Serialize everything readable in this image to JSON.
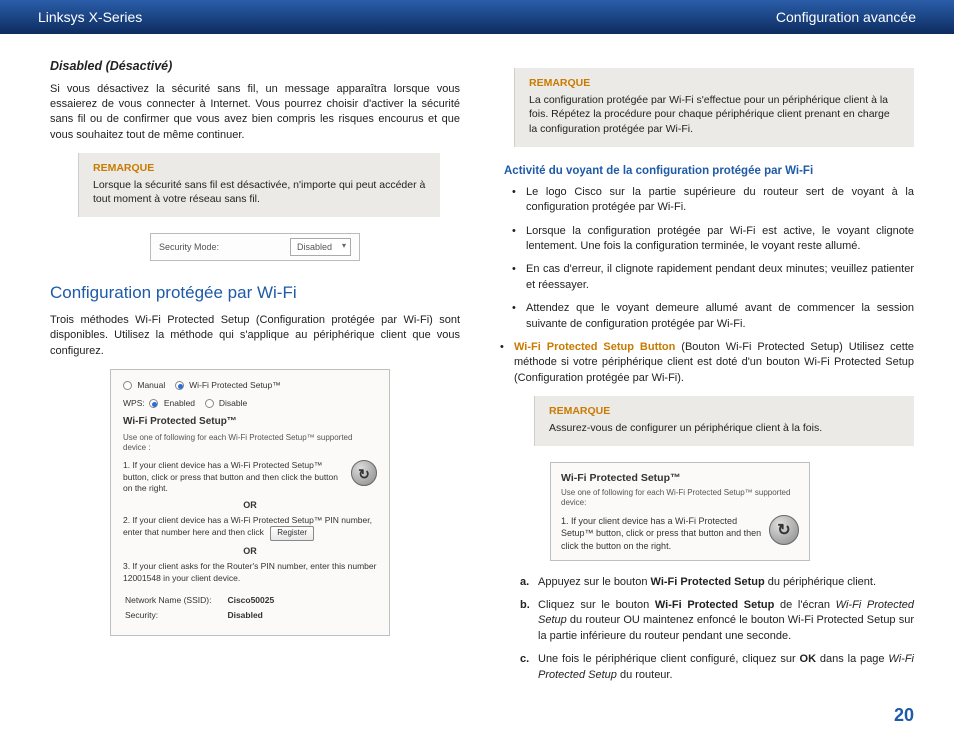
{
  "header": {
    "left": "Linksys X-Series",
    "right": "Configuration avancée"
  },
  "left": {
    "disabled_heading": "Disabled (Désactivé)",
    "disabled_body": "Si vous désactivez la sécurité sans fil, un message apparaîtra lorsque vous essaierez de vous connecter à Internet. Vous pourrez choisir d'activer la sécurité sans fil ou de confirmer que vous avez bien compris les risques encourus et que vous souhaitez tout de même continuer.",
    "note1": {
      "title": "REMARQUE",
      "body": "Lorsque la sécurité sans fil est désactivée, n'importe qui peut accéder à tout moment à votre réseau sans fil."
    },
    "security_label": "Security Mode:",
    "security_value": "Disabled",
    "wps_heading": "Configuration protégée par Wi-Fi",
    "wps_body": "Trois méthodes Wi-Fi Protected Setup (Configuration protégée par Wi-Fi) sont disponibles. Utilisez la méthode qui s'applique au périphérique client que vous configurez.",
    "panel": {
      "manual": "Manual",
      "wps": "Wi-Fi Protected Setup™",
      "wps_label": "WPS:",
      "enabled": "Enabled",
      "disabled": "Disable",
      "section": "Wi-Fi Protected Setup™",
      "sub": "Use one of following for each Wi-Fi Protected Setup™ supported device :",
      "step1": "1. If your client device has a Wi-Fi Protected Setup™ button, click or press that button and then click the button on the right.",
      "or": "OR",
      "step2a": "2. If your client device has a Wi-Fi Protected Setup™ PIN number, enter that number here",
      "register": "Register",
      "step2b": "and then click",
      "step3": "3. If your client asks for the Router's PIN number, enter this number 12001548 in your client device.",
      "ssid_label": "Network Name (SSID):",
      "ssid_value": "Cisco50025",
      "sec_label": "Security:",
      "sec_value": "Disabled"
    }
  },
  "right": {
    "note1": {
      "title": "REMARQUE",
      "body": "La configuration protégée par Wi-Fi s'effectue pour un périphérique client à la fois. Répétez la procédure pour chaque périphérique client prenant en charge la configuration protégée par Wi-Fi."
    },
    "activity_heading": "Activité du voyant de la configuration protégée par Wi-Fi",
    "bullets": [
      "Le logo Cisco sur la partie supérieure du routeur sert de voyant à la configuration protégée par Wi-Fi.",
      "Lorsque la configuration protégée par Wi-Fi est active, le voyant clignote lentement. Une fois la configuration terminée, le voyant reste allumé.",
      "En cas d'erreur, il clignote rapidement pendant deux minutes; veuillez patienter et réessayer.",
      "Attendez que le voyant demeure allumé avant de commencer la session suivante de configuration protégée par Wi-Fi."
    ],
    "wps_button_label": "Wi-Fi Protected Setup Button",
    "wps_button_text": "(Bouton Wi-Fi Protected Setup) Utilisez cette méthode si votre périphérique client est doté d'un bouton Wi-Fi Protected Setup (Configuration protégée par Wi-Fi).",
    "note2": {
      "title": "REMARQUE",
      "body": "Assurez-vous de configurer un périphérique client à la fois."
    },
    "mini": {
      "title": "Wi-Fi Protected Setup™",
      "sub": "Use one of following for each Wi-Fi Protected Setup™ supported device:",
      "text": "1. If your client device has a Wi-Fi Protected Setup™ button, click or press that button and then click the button on the right."
    },
    "steps": {
      "a_lead": "a.",
      "a_pre": "Appuyez sur le bouton ",
      "a_bold": "Wi-Fi Protected Setup",
      "a_post": " du périphérique client.",
      "b_lead": "b.",
      "b_pre": "Cliquez sur le bouton ",
      "b_bold": "Wi-Fi Protected Setup",
      "b_mid": " de l'écran ",
      "b_ital": "Wi-Fi Protected Setup",
      "b_post": " du routeur OU maintenez enfoncé le bouton Wi-Fi Protected Setup sur la partie inférieure du routeur pendant une seconde.",
      "c_lead": "c.",
      "c_pre": "Une fois le périphérique client configuré, cliquez sur ",
      "c_bold": "OK",
      "c_mid": " dans la page ",
      "c_ital": "Wi-Fi Protected Setup",
      "c_post": " du routeur."
    }
  },
  "page_number": "20"
}
